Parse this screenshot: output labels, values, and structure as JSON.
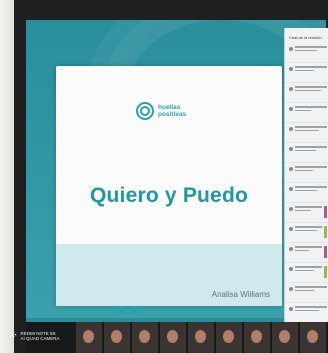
{
  "slide": {
    "logo_text": "huellas positivas",
    "title": "Quiero y Puedo",
    "presenter": "Analisa Williams"
  },
  "chat": {
    "title": "Chat de la reunión"
  },
  "watermark": {
    "line1": "REDMI NOTE 9S",
    "line2": "AI QUAD CAMERA"
  },
  "colors": {
    "teal": "#2aa1ae",
    "screen_bg": "#2c8d9a"
  }
}
